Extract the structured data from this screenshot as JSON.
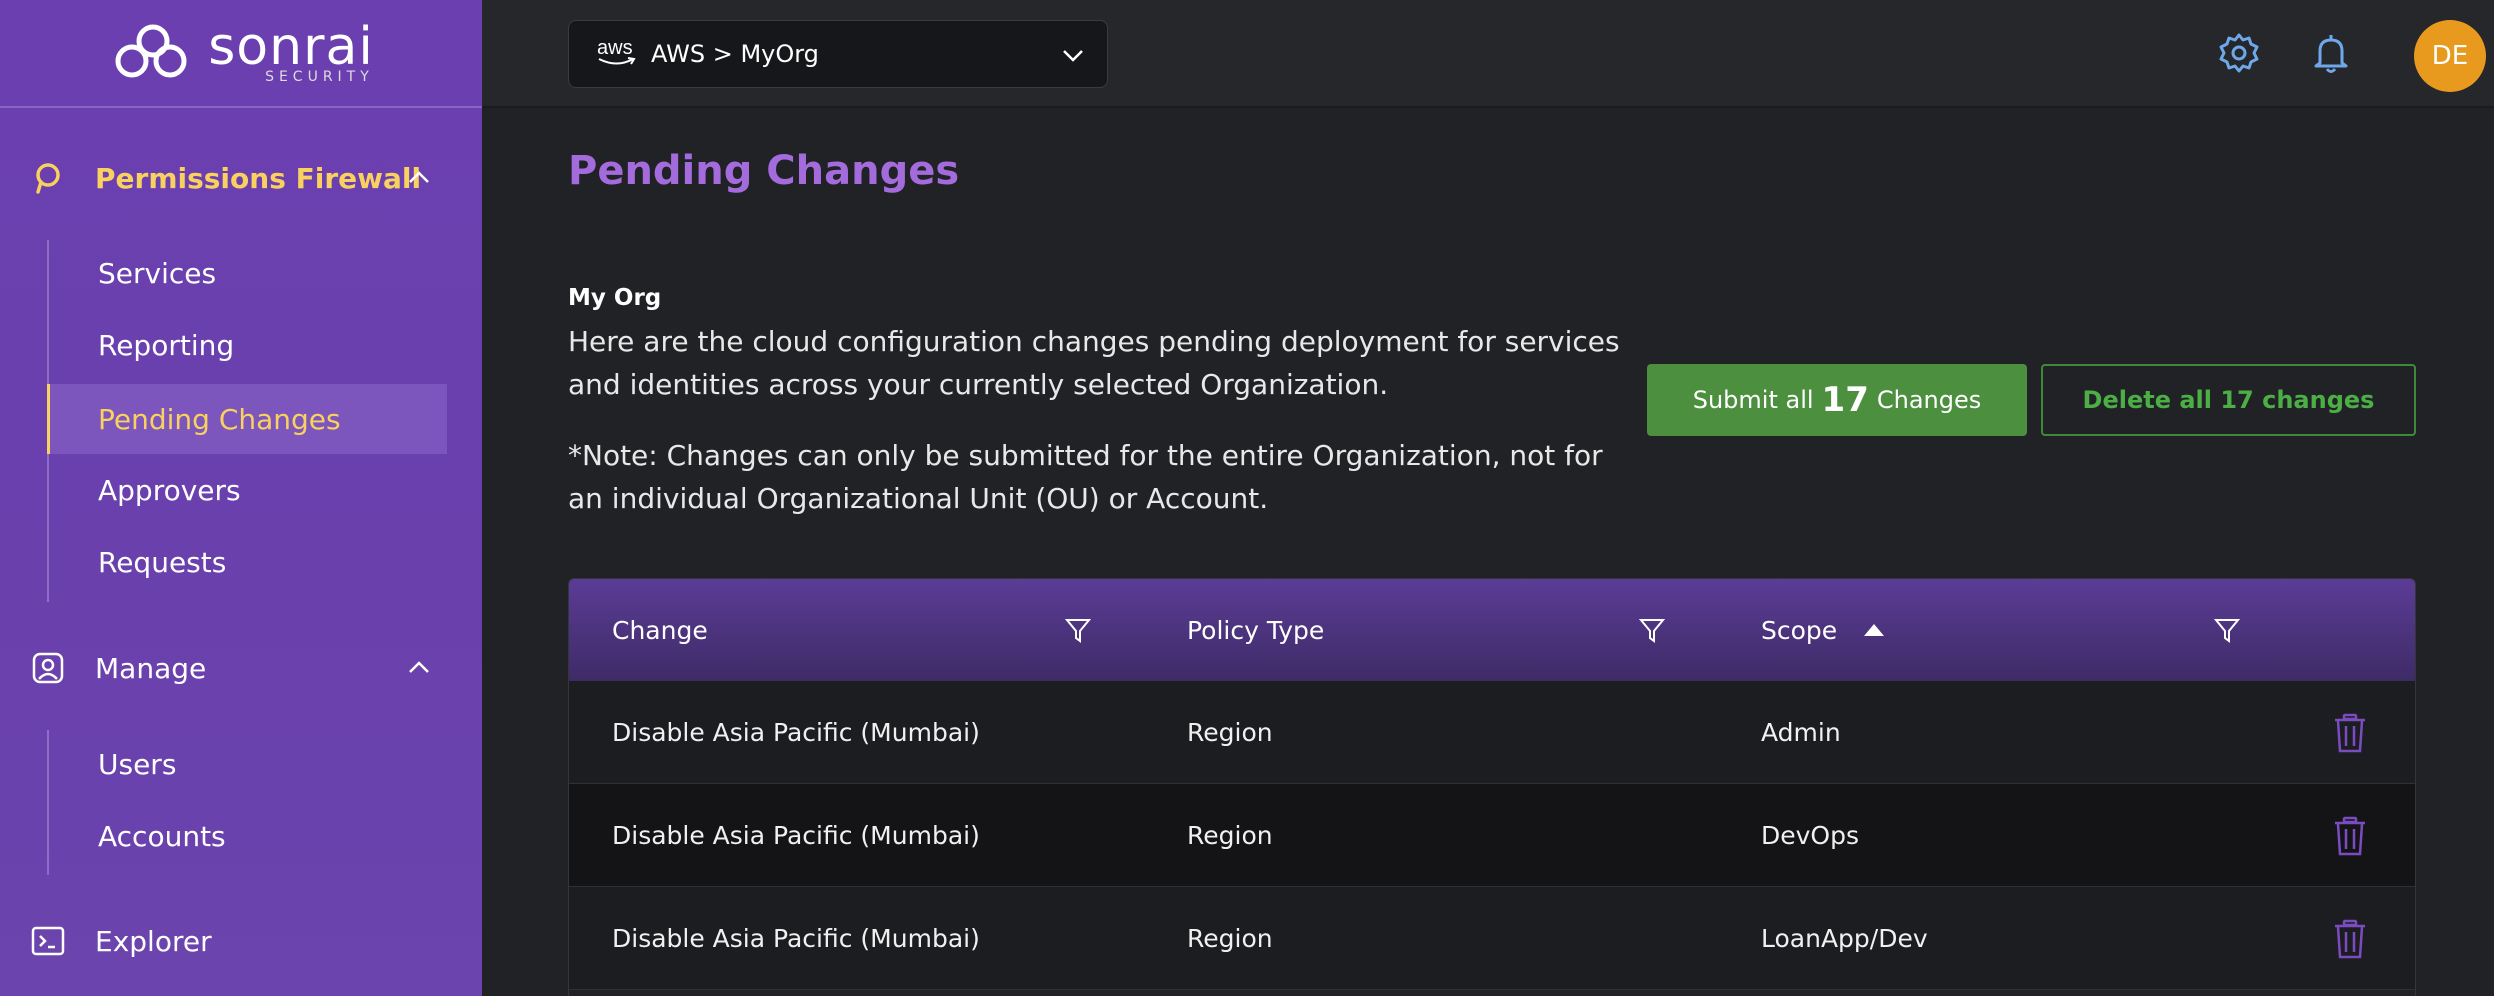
{
  "brand": {
    "name": "sonrai",
    "sub": "SECURITY"
  },
  "sidebar": {
    "sections": [
      {
        "label": "Permissions Firewall",
        "icon": "search-p-icon",
        "expanded": true,
        "items": [
          {
            "label": "Services"
          },
          {
            "label": "Reporting"
          },
          {
            "label": "Pending Changes",
            "active": true
          },
          {
            "label": "Approvers"
          },
          {
            "label": "Requests"
          }
        ]
      },
      {
        "label": "Manage",
        "icon": "user-badge-icon",
        "expanded": true,
        "items": [
          {
            "label": "Users"
          },
          {
            "label": "Accounts"
          }
        ]
      },
      {
        "label": "Explorer",
        "icon": "terminal-icon"
      }
    ]
  },
  "header": {
    "org_selector": {
      "cloud": "aws",
      "value": "AWS > MyOrg"
    },
    "avatar_initials": "DE"
  },
  "main": {
    "title": "Pending Changes",
    "org_name": "My Org",
    "description": "Here are the cloud configuration changes pending deployment for services and identities across your currently selected Organization.",
    "note": "*Note: Changes can only be submitted for the entire Organization, not for an individual Organizational Unit (OU) or Account.",
    "submit_prefix": "Submit all",
    "submit_count": "17",
    "submit_suffix": "Changes",
    "delete_label": "Delete all 17 changes"
  },
  "table": {
    "columns": [
      "Change",
      "Policy Type",
      "Scope"
    ],
    "rows": [
      {
        "change": "Disable Asia Pacific (Mumbai)",
        "policy_type": "Region",
        "scope": "Admin"
      },
      {
        "change": "Disable Asia Pacific (Mumbai)",
        "policy_type": "Region",
        "scope": "DevOps"
      },
      {
        "change": "Disable Asia Pacific (Mumbai)",
        "policy_type": "Region",
        "scope": "LoanApp/Dev"
      }
    ]
  },
  "colors": {
    "sidebar": "#6b3fb0",
    "accent_yellow": "#f8d15f",
    "title_purple": "#a46bdd",
    "submit_green": "#4b8f3f",
    "avatar_orange": "#e89a1f"
  }
}
